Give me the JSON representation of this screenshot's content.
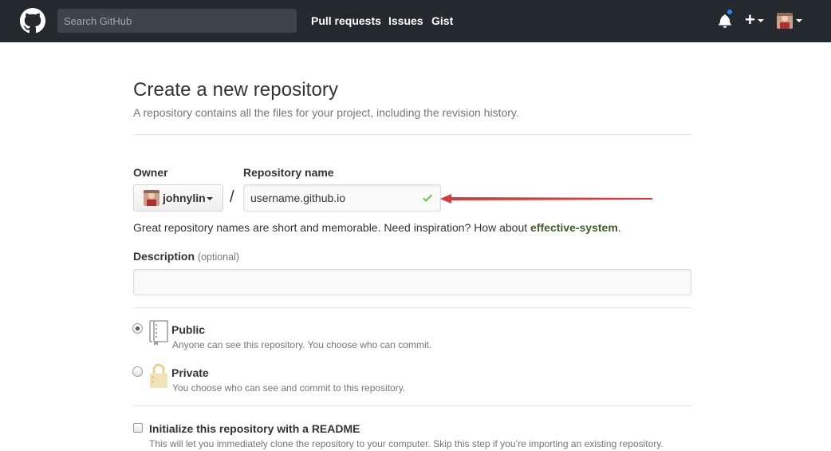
{
  "header": {
    "search_placeholder": "Search GitHub",
    "nav": [
      "Pull requests",
      "Issues",
      "Gist"
    ],
    "has_notification": true
  },
  "page": {
    "title": "Create a new repository",
    "subtitle": "A repository contains all the files for your project, including the revision history."
  },
  "form": {
    "owner_label": "Owner",
    "owner_value": "johnylin",
    "separator": "/",
    "repo_label": "Repository name",
    "repo_value": "username.github.io",
    "repo_valid": true,
    "hint_prefix": "Great repository names are short and memorable. Need inspiration? How about ",
    "hint_suggestion": "effective-system",
    "hint_suffix": ".",
    "description_label": "Description",
    "description_optional": "(optional)",
    "description_value": "",
    "visibility": {
      "selected": "public",
      "public_title": "Public",
      "public_note": "Anyone can see this repository. You choose who can commit.",
      "private_title": "Private",
      "private_note": "You choose who can see and commit to this repository."
    },
    "init_readme": {
      "checked": false,
      "title": "Initialize this repository with a README",
      "note": "This will let you immediately clone the repository to your computer. Skip this step if you’re importing an existing repository."
    }
  },
  "annotation": {
    "arrow_color": "#d73a3a"
  },
  "colors": {
    "header_bg": "#24292e",
    "valid_check": "#6cc644",
    "suggestion": "#3a5f29"
  }
}
